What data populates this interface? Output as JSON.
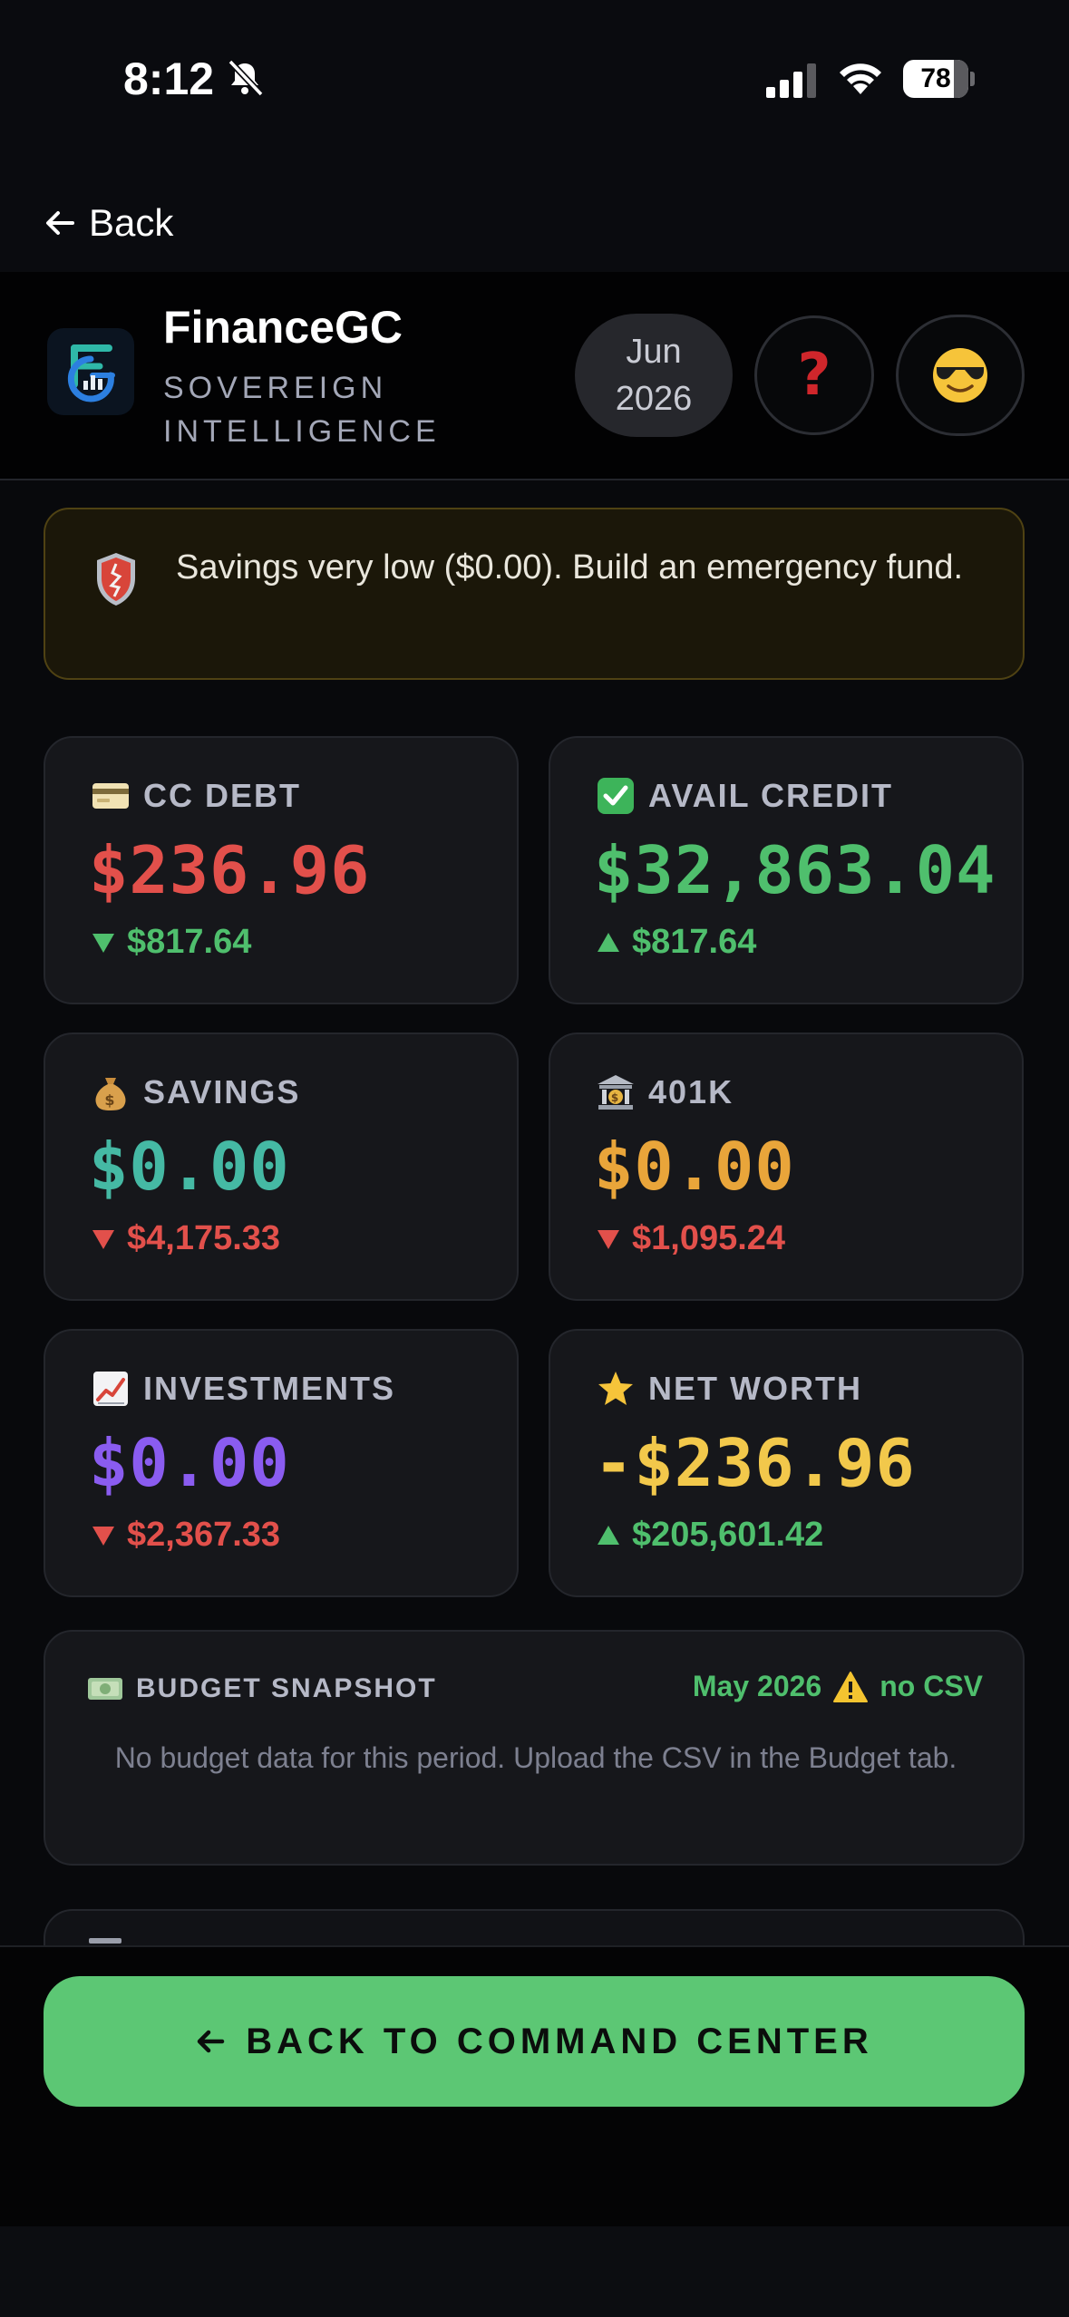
{
  "status_bar": {
    "time": "8:12",
    "battery": "78",
    "battery_level": 0.78
  },
  "nav": {
    "back_label": "Back"
  },
  "header": {
    "app_name": "FinanceGC",
    "tagline": "SOVEREIGN INTELLIGENCE",
    "period_month": "Jun",
    "period_year": "2026",
    "help_glyph": "?",
    "profile_icon": "sunglasses-face-icon"
  },
  "alert": {
    "icon": "shield-icon",
    "message": "Savings very low ($0.00). Build an emergency fund."
  },
  "cards": [
    {
      "icon": "credit-card-icon",
      "label": "CC DEBT",
      "value": "$236.96",
      "value_color": "#e2504b",
      "delta": "$817.64",
      "delta_dir": "down",
      "delta_color": "#4fbf6d"
    },
    {
      "icon": "check-box-icon",
      "label": "AVAIL CREDIT",
      "value": "$32,863.04",
      "value_color": "#4fbf6d",
      "delta": "$817.64",
      "delta_dir": "up",
      "delta_color": "#4fbf6d"
    },
    {
      "icon": "money-bag-icon",
      "label": "SAVINGS",
      "value": "$0.00",
      "value_color": "#45b9a4",
      "delta": "$4,175.33",
      "delta_dir": "down",
      "delta_color": "#e2504b"
    },
    {
      "icon": "bank-icon",
      "label": "401K",
      "value": "$0.00",
      "value_color": "#e9a53a",
      "delta": "$1,095.24",
      "delta_dir": "down",
      "delta_color": "#e2504b"
    },
    {
      "icon": "chart-up-icon",
      "label": "INVESTMENTS",
      "value": "$0.00",
      "value_color": "#8a5cf0",
      "delta": "$2,367.33",
      "delta_dir": "down",
      "delta_color": "#e2504b"
    },
    {
      "icon": "star-icon",
      "label": "NET WORTH",
      "value": "-$236.96",
      "value_color": "#f2c84b",
      "delta": "$205,601.42",
      "delta_dir": "up",
      "delta_color": "#4fbf6d"
    }
  ],
  "budget": {
    "icon": "dollar-bill-icon",
    "title": "BUDGET SNAPSHOT",
    "period": "May 2026",
    "warning_icon": "warning-icon",
    "status": "no CSV",
    "message": "No budget data for this period. Upload the CSV in the Budget tab."
  },
  "cta": {
    "label": "BACK TO COMMAND CENTER"
  },
  "colors": {
    "accent_green": "#5cc774",
    "negative_red": "#e2504b",
    "card_bg": "#16171b"
  }
}
